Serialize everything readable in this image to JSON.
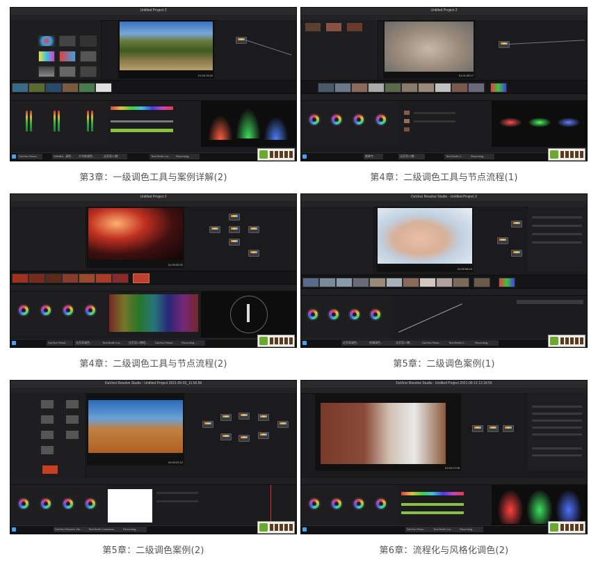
{
  "captions": [
    "第3章：一级调色工具与案例详解(2)",
    "第4章：二级调色工具与节点流程(1)",
    "第4章：二级调色工具与节点流程(2)",
    "第5章：二级调色案例(1)",
    "第5章：二级调色案例(2)",
    "第6章：流程化与风格化调色(2)"
  ],
  "screens": [
    {
      "title": "Untitled Project 2",
      "timecode": "01:00:19:20",
      "taskbar": [
        "DaVinci Resol...",
        "SAMBA - 调色...",
        "大书库调色...",
        "达芬奇17教...",
        "TechSmith Ca...",
        "Recording..."
      ]
    },
    {
      "title": "Untitled Project 2",
      "timecode": "01:01:05:17",
      "taskbar": [
        "剪映专",
        "达芬奇17教...",
        "TechSmith C...",
        "Recording..."
      ]
    },
    {
      "title": "Untitled Project 2",
      "timecode": "01:29:32:02",
      "taskbar": [
        "DaVinci Resol...",
        "达芬奇调色...",
        "TechSmith Ca...",
        "达芬奇17教程...",
        "DaVinci Resol...",
        "Recording..."
      ]
    },
    {
      "title": "DaVinci Resolve Studio - Untitled Project 2",
      "timecode": "01:00:58:29",
      "taskbar": [
        "达芬奇调色...",
        "剪辑调色...",
        "达芬奇17教...",
        "DaVinci Reso...",
        "TechSmith C...",
        "Recording..."
      ]
    },
    {
      "title": "DaVinci Resolve Studio - Untitled Project 2021-09-03_11:56:58",
      "timecode": "01:00:22:12",
      "taskbar": [
        "DaVinci Resolve Stu...",
        "TechSmith Camtasia...",
        "Recording..."
      ]
    },
    {
      "title": "DaVinci Resolve Studio - Untitled Project 2021-09-12 12:18:55",
      "timecode": "01:00:17:05",
      "taskbar": [
        "DaVinci Reso...",
        "TechSmith Ca...",
        "Recording..."
      ]
    }
  ],
  "colors": {
    "ui_bg": "#1b1b1d",
    "caption": "#555555",
    "accent_orange": "#d97a2a"
  }
}
